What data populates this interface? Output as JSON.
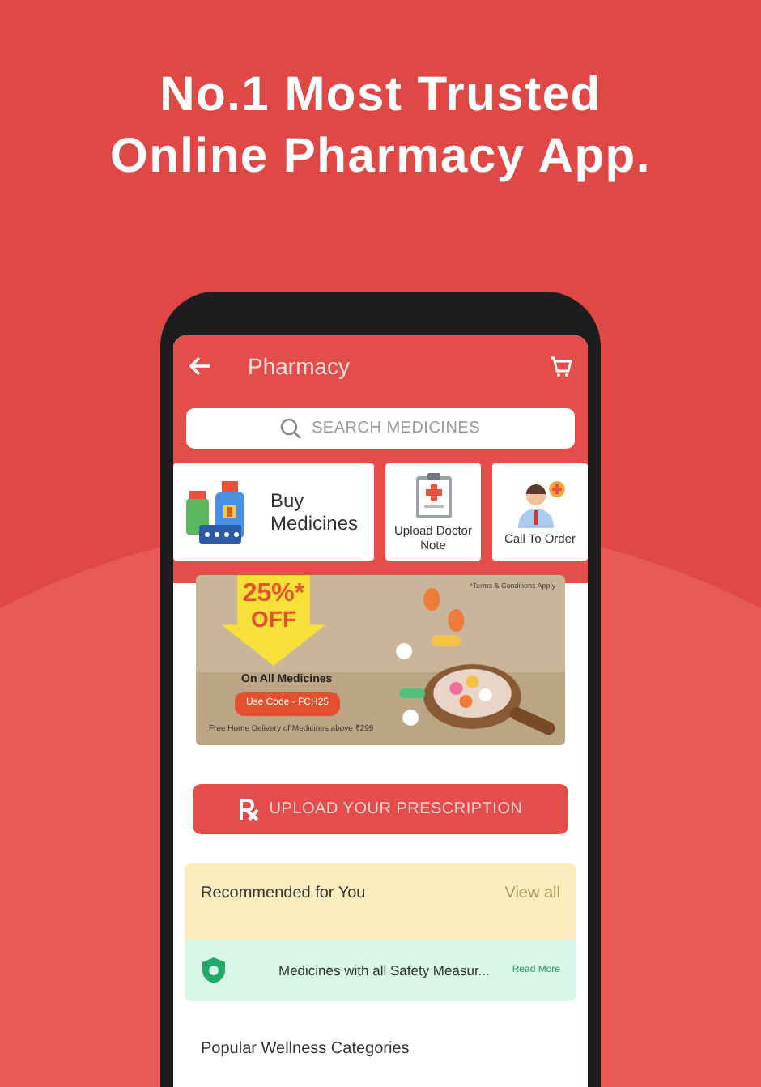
{
  "headline": [
    "No.1 Most Trusted",
    "Online Pharmacy App."
  ],
  "app_bar": {
    "title": "Pharmacy"
  },
  "search": {
    "placeholder": "SEARCH MEDICINES"
  },
  "tiles": [
    {
      "kind": "large",
      "label": "Buy Medicines"
    },
    {
      "kind": "note",
      "label": "Upload Doctor Note"
    },
    {
      "kind": "call",
      "label": "Call To Order"
    }
  ],
  "banner": {
    "terms": "*Terms & Conditions Apply",
    "discount": "25%*",
    "discount_word": "OFF",
    "subtitle": "On All Medicines",
    "code": "Use Code - FCH25",
    "footer": "Free Home Delivery of Medicines above ₹299"
  },
  "upload_button": {
    "label": "UPLOAD YOUR PRESCRIPTION"
  },
  "recommended": {
    "title": "Recommended for You",
    "link": "View all"
  },
  "safety": {
    "text": "Medicines with all Safety Measur...",
    "link": "Read More"
  },
  "popular": {
    "title": "Popular Wellness Categories"
  }
}
